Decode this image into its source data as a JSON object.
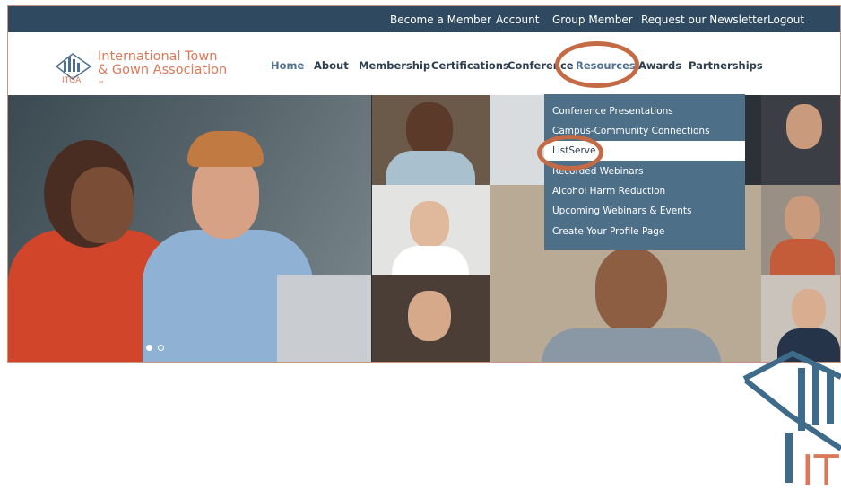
{
  "topbar": {
    "links": [
      "Become a Member",
      "Account",
      "Group Member",
      "Request our Newsletter",
      "Logout"
    ]
  },
  "brand": {
    "logo_text": "ITGA",
    "name_line1": "International Town",
    "name_line2": "& Gown Association",
    "trademark": "™"
  },
  "nav": {
    "items": [
      "Home",
      "About",
      "Membership",
      "Certifications",
      "Conference",
      "Resources",
      "Awards",
      "Partnerships"
    ],
    "active": "Home",
    "open_menu": "Resources"
  },
  "resources_menu": {
    "items": [
      "Conference Presentations",
      "Campus-Community Connections",
      "ListServe",
      "Recorded Webinars",
      "Alcohol Harm Reduction",
      "Upcoming Webinars & Events",
      "Create Your Profile Page"
    ],
    "selected": "ListServe"
  },
  "slider": {
    "slide_count": 2,
    "current_slide": 1
  },
  "colors": {
    "topbar": "#2f4a60",
    "nav_text": "#2d3e4f",
    "brand_orange": "#d9795a",
    "dropdown_bg": "#4e6f88",
    "highlight_ring": "#c46b45"
  }
}
